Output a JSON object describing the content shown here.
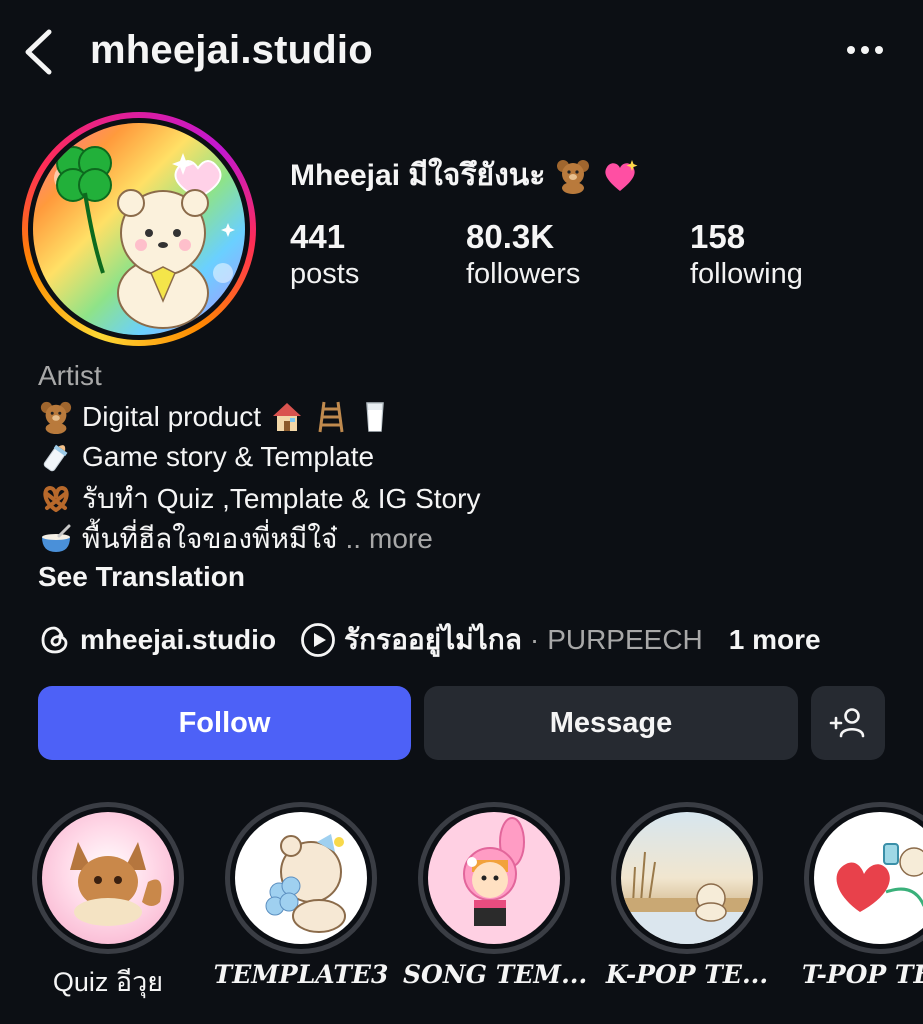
{
  "header": {
    "username": "mheejai.studio",
    "back_icon": "chevron-left-icon",
    "menu_icon": "more-horizontal-icon"
  },
  "profile": {
    "display_name": "Mheejai มีใจรึยังนะ",
    "stats": {
      "posts_count": "441",
      "posts_label": "posts",
      "followers_count": "80.3K",
      "followers_label": "followers",
      "following_count": "158",
      "following_label": "following"
    },
    "category": "Artist",
    "bio": [
      {
        "text": "Digital product",
        "icon": "teddy-bear-icon"
      },
      {
        "text": "Game story & Template",
        "icon": "baby-bottle-icon"
      },
      {
        "text": "รับทำ Quiz ,Template & IG Story",
        "icon": "pretzel-icon"
      },
      {
        "text": "พื้นที่ฮีลใจของพี่หมีใจ๋",
        "icon": "bowl-icon"
      }
    ],
    "bio_ellipsis": "..",
    "bio_more": "more",
    "see_translation": "See Translation"
  },
  "links": {
    "threads_handle": "mheejai.studio",
    "music_title": "รักรออยู่ไม่ไกล",
    "separator": "·",
    "music_artist": "PURPEECH",
    "more_count": "1 more"
  },
  "actions": {
    "follow_label": "Follow",
    "message_label": "Message",
    "add_friend_icon": "add-person-icon"
  },
  "highlights": [
    {
      "label": "Quiz อีวุย"
    },
    {
      "label": "TEMPLATE3"
    },
    {
      "label": "SONG TEM..."
    },
    {
      "label": "K-POP TE..."
    },
    {
      "label": "T-POP TE"
    }
  ],
  "colors": {
    "background": "#0c0f14",
    "follow_button": "#4d61f7",
    "secondary_button": "#262a31",
    "muted_text": "#a8a8a8"
  }
}
